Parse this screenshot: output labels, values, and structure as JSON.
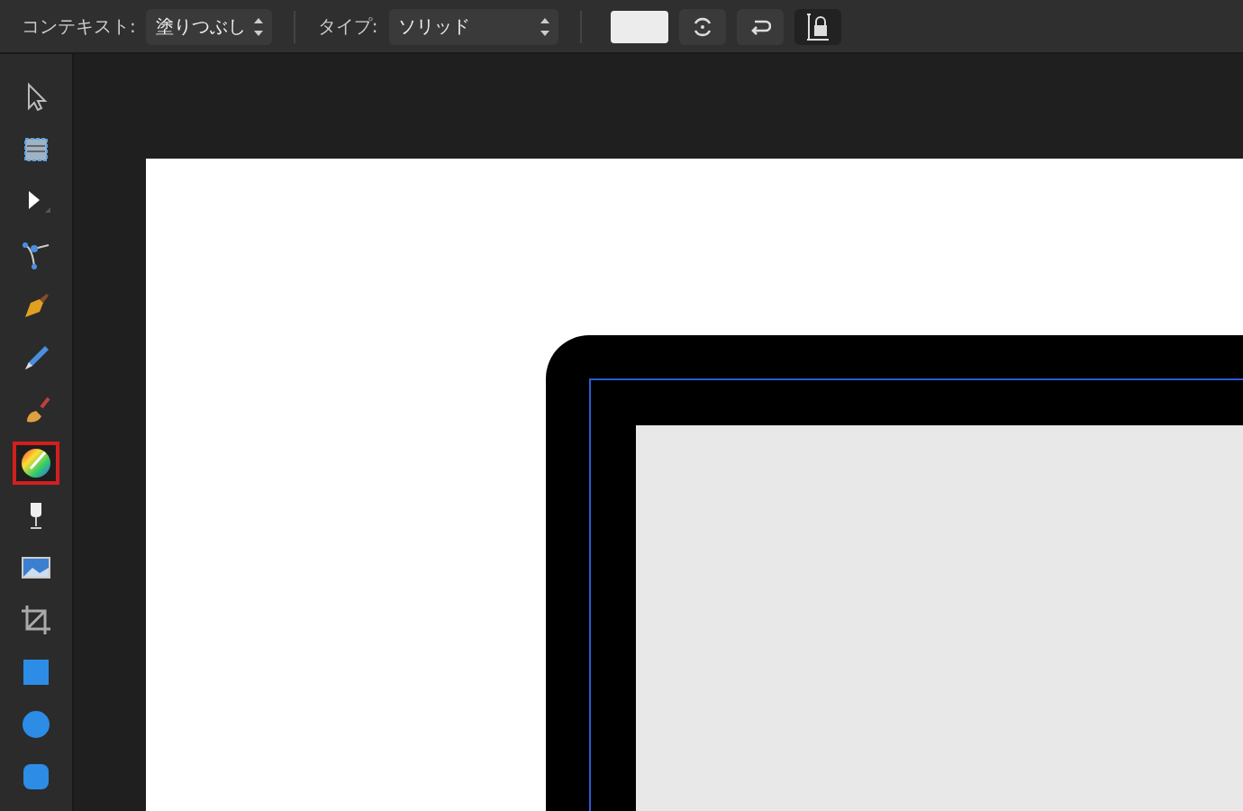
{
  "context_bar": {
    "context_label": "コンテキスト:",
    "context_value": "塗りつぶし",
    "type_label": "タイプ:",
    "type_value": "ソリッド"
  },
  "tools": [
    {
      "kind": "pointer",
      "selected": false
    },
    {
      "kind": "artboard",
      "selected": false
    },
    {
      "kind": "node",
      "selected": false
    },
    {
      "kind": "corner",
      "selected": false
    },
    {
      "kind": "pen",
      "selected": false
    },
    {
      "kind": "pencil",
      "selected": false
    },
    {
      "kind": "brush",
      "selected": false
    },
    {
      "kind": "fill",
      "selected": true
    },
    {
      "kind": "transparency",
      "selected": false
    },
    {
      "kind": "image",
      "selected": false
    },
    {
      "kind": "crop",
      "selected": false
    },
    {
      "kind": "rectangle",
      "selected": false
    },
    {
      "kind": "ellipse",
      "selected": false
    },
    {
      "kind": "rounded",
      "selected": false
    }
  ]
}
